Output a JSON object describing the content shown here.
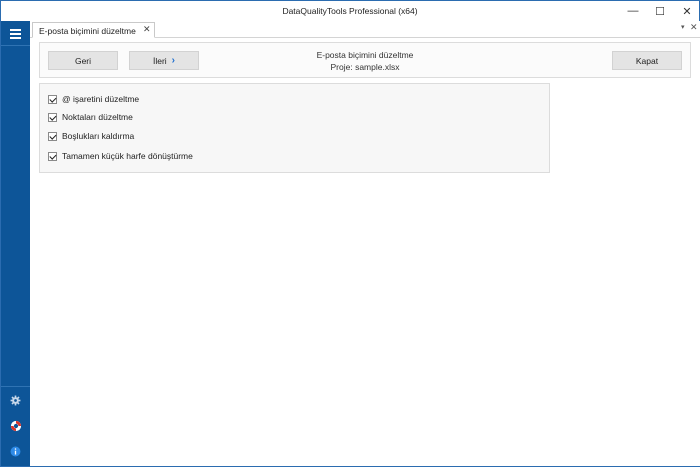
{
  "window": {
    "title": "DataQualityTools Professional (x64)",
    "minimize": "—",
    "maximize": "☐",
    "close": "✕"
  },
  "sidebar": {
    "icons": [
      "menu-icon",
      "gear-icon",
      "lifebuoy-icon",
      "info-icon"
    ],
    "accent": "#0d5598"
  },
  "tabs": [
    {
      "label": "E-posta biçimini düzeltme",
      "close": "✕"
    }
  ],
  "tabstrip": {
    "menu": "▾",
    "close": "✕"
  },
  "toolbar": {
    "back_label": "Geri",
    "next_label": "İleri",
    "next_chevron": "›",
    "close_label": "Kapat",
    "title": "E-posta biçimini düzeltme",
    "subtitle": "Proje: sample.xlsx"
  },
  "options": [
    {
      "label": "@ işaretini düzeltme",
      "checked": true
    },
    {
      "label": "Noktaları düzeltme",
      "checked": true
    },
    {
      "label": "Boşlukları kaldırma",
      "checked": true
    },
    {
      "label": "Tamamen küçük harfe dönüştürme",
      "checked": true
    }
  ]
}
